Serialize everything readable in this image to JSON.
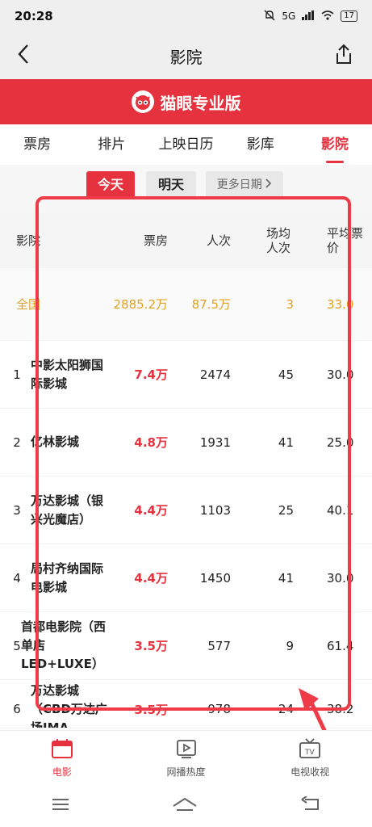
{
  "status_bar": {
    "time": "20:28",
    "signal_text": "5G",
    "battery": "17"
  },
  "nav": {
    "title": "影院"
  },
  "banner": {
    "text": "猫眼专业版"
  },
  "tabs": [
    {
      "label": "票房"
    },
    {
      "label": "排片"
    },
    {
      "label": "上映日历"
    },
    {
      "label": "影库"
    },
    {
      "label": "影院",
      "active": true
    }
  ],
  "dates": {
    "today": "今天",
    "tomorrow": "明天",
    "more": "更多日期"
  },
  "table": {
    "headers": {
      "name": "影院",
      "box": "票房",
      "people": "人次",
      "avg": "场均人次",
      "price": "平均票价"
    },
    "total": {
      "name": "全国",
      "box": "2885.2万",
      "people": "87.5万",
      "avg": "3",
      "price": "33.0"
    },
    "rows": [
      {
        "rank": "1",
        "name": "中影太阳狮国际影城",
        "box": "7.4万",
        "people": "2474",
        "avg": "45",
        "price": "30.0"
      },
      {
        "rank": "2",
        "name": "亿林影城",
        "box": "4.8万",
        "people": "1931",
        "avg": "41",
        "price": "25.0"
      },
      {
        "rank": "3",
        "name": "万达影城（银兴光魔店）",
        "box": "4.4万",
        "people": "1103",
        "avg": "25",
        "price": "40.1"
      },
      {
        "rank": "4",
        "name": "局村齐纳国际电影城",
        "box": "4.4万",
        "people": "1450",
        "avg": "41",
        "price": "30.0"
      },
      {
        "rank": "5",
        "name": "首都电影院（西单店LED+LUXE）",
        "box": "3.5万",
        "people": "577",
        "avg": "9",
        "price": "61.4"
      },
      {
        "rank": "6",
        "name": "万达影城（CBD万达广场IMA",
        "box": "3.5万",
        "people": "978",
        "avg": "24",
        "price": "38.2"
      }
    ]
  },
  "bottom_nav": [
    {
      "label": "电影",
      "icon": "calendar-icon",
      "active": true
    },
    {
      "label": "网播热度",
      "icon": "play-icon"
    },
    {
      "label": "电视收视",
      "icon": "tv-icon"
    }
  ],
  "colors": {
    "accent": "#e5323e",
    "total_row": "#e1a21f",
    "annotation": "#ee3b47"
  }
}
